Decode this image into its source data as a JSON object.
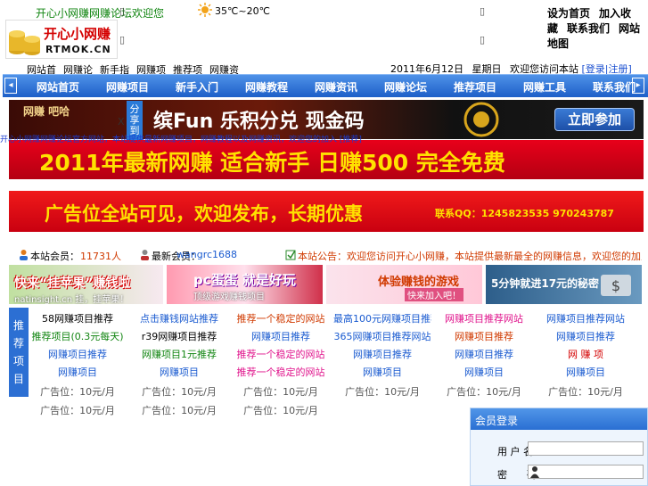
{
  "header": {
    "slogan": "开心小网赚网赚论坛欢迎您",
    "logo_text": "开心小网赚",
    "logo_sub": "RTMOK.CN",
    "weather": "35℃~20℃",
    "broken_glyph": "▯",
    "top_links": [
      "设为首页",
      "加入收藏",
      "联系我们",
      "网站地图"
    ],
    "sub_nav": [
      "网站首页",
      "网赚论坛",
      "新手指南",
      "网赚项目",
      "推荐项目",
      "网赚资讯"
    ],
    "date": "2011年6月12日",
    "weekday": "星期日",
    "date_extra": "欢迎您访问本站",
    "date_links": "[登录|注册]"
  },
  "main_nav": [
    "网站首页",
    "网赚项目",
    "新手入门",
    "网赚教程",
    "网赚资讯",
    "网赚论坛",
    "推荐项目",
    "网赚工具",
    "联系我们"
  ],
  "nav_arrows": {
    "left": "◂",
    "right": "▸"
  },
  "banners": {
    "b1_text": "缤Fun  乐积分兑 现金码",
    "b1_button": "立即参加",
    "b1_left": "网赚 吧哈",
    "b2_text": "2011年最新网赚  适合新手  日赚500  完全免费",
    "b3_text": "广告位全站可见，欢迎发布，长期优惠",
    "b3_contact": "联系QQ：1245823535   970243787"
  },
  "share": {
    "label": "分享到",
    "close": "X"
  },
  "overlay_text": "开心小网赚网赚论坛官方网站，本站提供最新网赚项目，网赚教程以及网赚资讯，欢迎您的加入 [推荐]",
  "stats": {
    "members_label": "本站会员：",
    "members_count": "11731人",
    "newest_label": "最新会员：",
    "newest_name": "wangrc1688",
    "notice": "本站公告：欢迎您访问开心小网赚，本站提供最新最全的网赚信息，欢迎您的加入，祝您网赚愉快！"
  },
  "ads": [
    {
      "title": "快来“挂苹果”赚钱啦",
      "sub": "natinsight.cn 挂，挂苹果！"
    },
    {
      "title": "pc蛋蛋 就是好玩",
      "sub": "顶级游戏赚钱项目"
    },
    {
      "title": "体验赚钱的游戏",
      "sub": "快来加入吧！"
    },
    {
      "title": "5分钟就进17元的秘密",
      "sub": ""
    }
  ],
  "side_label": "推荐项目",
  "grid": [
    [
      "58网赚项目推荐",
      "点击赚钱网站推荐",
      "推荐一个稳定的网站",
      "最高100元网赚项目推荐",
      "网赚项目推荐网站",
      "网赚项目推荐网站"
    ],
    [
      "推荐项目(0.3元每天)",
      "r39网赚项目推荐",
      "网赚项目推荐",
      "365网赚项目推荐网站",
      "网赚项目推荐",
      "网赚项目推荐"
    ],
    [
      "网赚项目推荐",
      "网赚项目1元推荐",
      "推荐一个稳定的网站",
      "网赚项目推荐",
      "网赚项目推荐",
      "网 赚 项"
    ],
    [
      "网赚项目",
      "网赚项目",
      "推荐一个稳定的网站",
      "网赚项目",
      "网赚项目",
      "网赚项目"
    ],
    [
      "广告位：10元/月",
      "广告位：10元/月",
      "广告位：10元/月",
      "广告位：10元/月",
      "广告位：10元/月",
      "广告位：10元/月"
    ],
    [
      "广告位：10元/月",
      "广告位：10元/月",
      "广告位：10元/月"
    ]
  ],
  "grid_colors": [
    [
      "#000000",
      "#1a5bd0",
      "#d03a00",
      "#1a5bd0",
      "#e0148c",
      "#1a5bd0"
    ],
    [
      "#118511",
      "#000000",
      "#1a5bd0",
      "#1a5bd0",
      "#d03a00",
      "#1a5bd0"
    ],
    [
      "#1a5bd0",
      "#118511",
      "#e0148c",
      "#1a5bd0",
      "#1a5bd0",
      "#d40000"
    ],
    [
      "#1a5bd0",
      "#1a5bd0",
      "#e0148c",
      "#1a5bd0",
      "#1a5bd0",
      "#1a5bd0"
    ],
    [
      "#555555",
      "#555555",
      "#555555",
      "#555555",
      "#555555",
      "#555555"
    ],
    [
      "#555555",
      "#555555",
      "#555555"
    ]
  ],
  "login": {
    "title": "会员登录",
    "user_label": "用 户 名",
    "pass_label": "密　　码"
  },
  "colors": {
    "nav_blue": "#2a6fd3",
    "accent_red": "#d40000"
  }
}
